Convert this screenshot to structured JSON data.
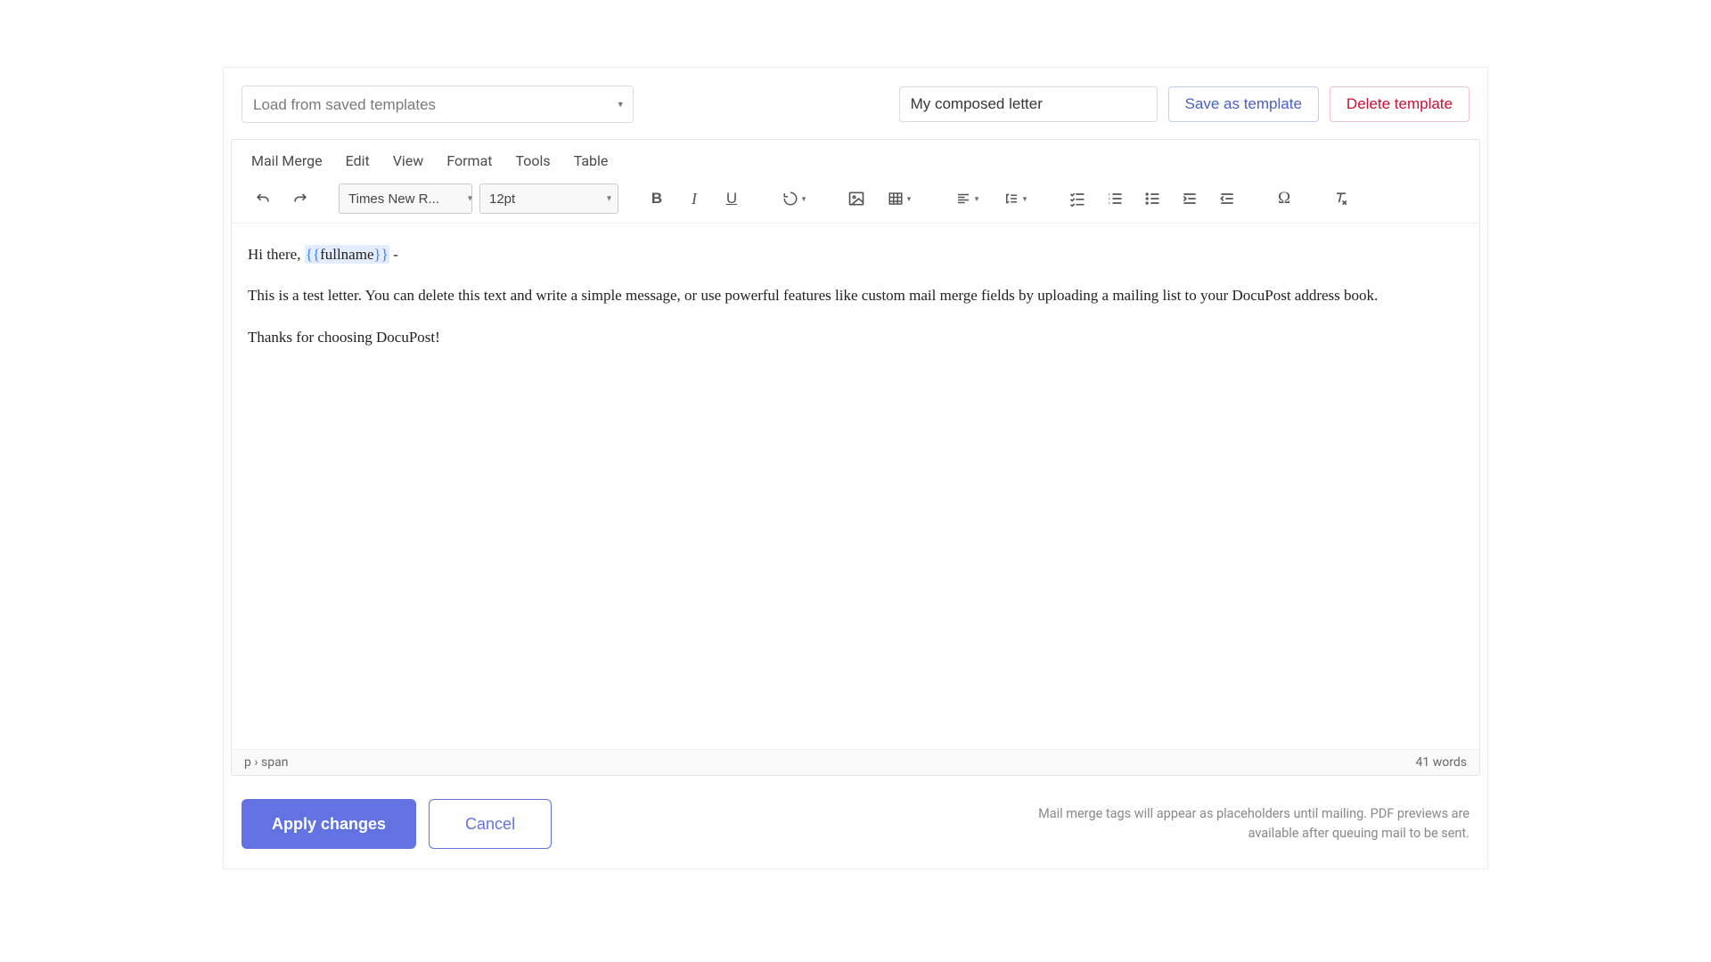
{
  "top": {
    "template_placeholder": "Load from saved templates",
    "title_value": "My composed letter",
    "save_label": "Save as template",
    "delete_label": "Delete template"
  },
  "menubar": [
    "Mail Merge",
    "Edit",
    "View",
    "Format",
    "Tools",
    "Table"
  ],
  "toolbar": {
    "font_family": "Times New R...",
    "font_size": "12pt"
  },
  "content": {
    "greeting_pre": "Hi there, ",
    "merge_open": "{{",
    "merge_field": "fullname",
    "merge_close": "}}",
    "greeting_post": " -",
    "body": "This is a test letter. You can delete this text and write a simple message, or use powerful features like custom mail merge fields by uploading a mailing list to your DocuPost address book.",
    "thanks": "Thanks for choosing DocuPost!"
  },
  "status": {
    "path_p": "p",
    "path_sep": " › ",
    "path_span": "span",
    "word_count": "41 words"
  },
  "bottom": {
    "apply": "Apply changes",
    "cancel": "Cancel",
    "note": "Mail merge tags will appear as placeholders until mailing.  PDF previews are available after queuing mail to be sent."
  }
}
